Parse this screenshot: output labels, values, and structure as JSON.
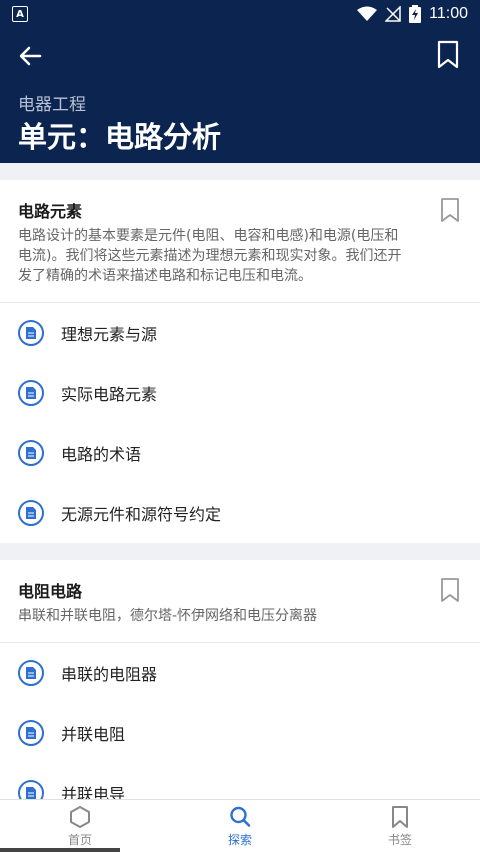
{
  "status_bar": {
    "app_badge": "A",
    "time": "11:00"
  },
  "header": {
    "subtitle": "电器工程",
    "title": "单元：电路分析"
  },
  "sections": [
    {
      "name": "电路元素",
      "description": "电路设计的基本要素是元件(电阻、电容和电感)和电源(电压和电流)。我们将这些元素描述为理想元素和现实对象。我们还开发了精确的术语来描述电路和标记电压和电流。",
      "lessons": [
        "理想元素与源",
        "实际电路元素",
        "电路的术语",
        "无源元件和源符号约定"
      ]
    },
    {
      "name": "电阻电路",
      "description": "串联和并联电阻，德尔塔-怀伊网络和电压分离器",
      "lessons": [
        "串联的电阻器",
        "并联电阻",
        "并联电导"
      ]
    }
  ],
  "bottom_nav": [
    {
      "label": "首页",
      "icon": "hexagon-icon",
      "active": false
    },
    {
      "label": "探索",
      "icon": "search-icon",
      "active": true
    },
    {
      "label": "书签",
      "icon": "bookmark-icon",
      "active": false
    }
  ],
  "colors": {
    "header_bg": "#0c2450",
    "accent": "#2f6fcf"
  }
}
